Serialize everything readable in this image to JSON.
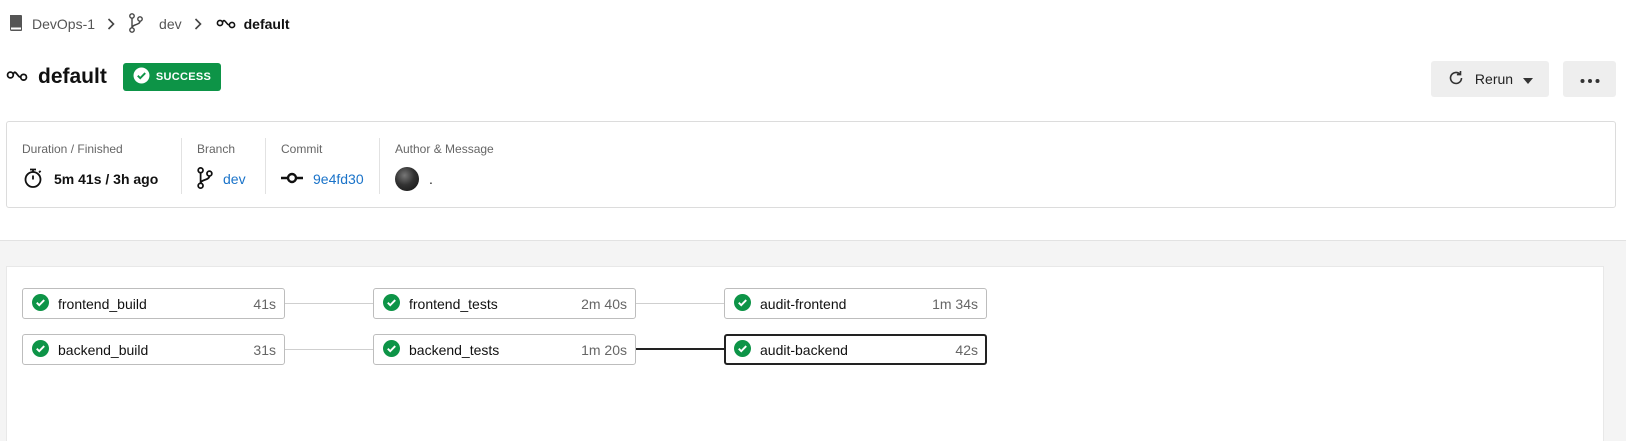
{
  "breadcrumb": {
    "project": "DevOps-1",
    "branch": "dev",
    "workflow": "default"
  },
  "header": {
    "title": "default",
    "status": "SUCCESS",
    "rerun_label": "Rerun"
  },
  "info": {
    "duration": {
      "label": "Duration / Finished",
      "value": "5m 41s / 3h ago"
    },
    "branch": {
      "label": "Branch",
      "value": "dev"
    },
    "commit": {
      "label": "Commit",
      "value": "9e4fd30"
    },
    "author": {
      "label": "Author & Message",
      "message": "."
    }
  },
  "colors": {
    "success": "#0d9447",
    "link": "#1a73c9"
  },
  "pipeline": {
    "jobs": [
      {
        "name": "frontend_build",
        "duration": "41s",
        "status": "success"
      },
      {
        "name": "frontend_tests",
        "duration": "2m 40s",
        "status": "success"
      },
      {
        "name": "audit-frontend",
        "duration": "1m 34s",
        "status": "success"
      },
      {
        "name": "backend_build",
        "duration": "31s",
        "status": "success"
      },
      {
        "name": "backend_tests",
        "duration": "1m 20s",
        "status": "success"
      },
      {
        "name": "audit-backend",
        "duration": "42s",
        "status": "success",
        "selected": true
      }
    ]
  }
}
